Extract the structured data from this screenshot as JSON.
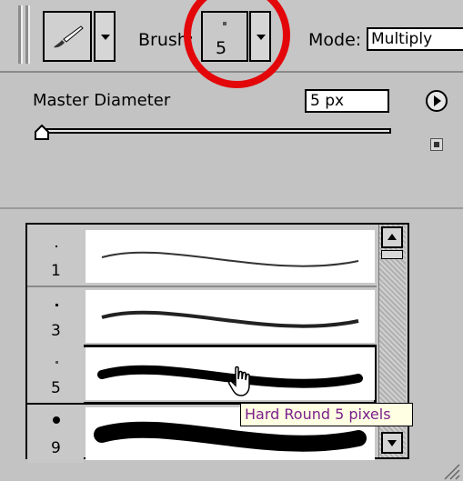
{
  "options_bar": {
    "brush_label": "Brush:",
    "brush_preset_size": "5",
    "mode_label": "Mode:",
    "mode_value": "Multiply"
  },
  "panel": {
    "master_diameter_label": "Master Diameter",
    "master_diameter_value": "5 px"
  },
  "brush_list": {
    "items": [
      {
        "size_label": "1",
        "selected": false
      },
      {
        "size_label": "3",
        "selected": false
      },
      {
        "size_label": "5",
        "selected": true
      },
      {
        "size_label": "9",
        "selected": false
      }
    ]
  },
  "tooltip": "Hard Round 5 pixels",
  "icons": [
    "brush-tool-icon",
    "dropdown-arrow-icon",
    "panel-menu-icon",
    "hand-cursor-icon",
    "resize-grip-icon"
  ],
  "colors": {
    "highlight_circle": "#e3070a",
    "tooltip_text": "#7b1f8c",
    "tooltip_bg": "#ffffe3"
  }
}
